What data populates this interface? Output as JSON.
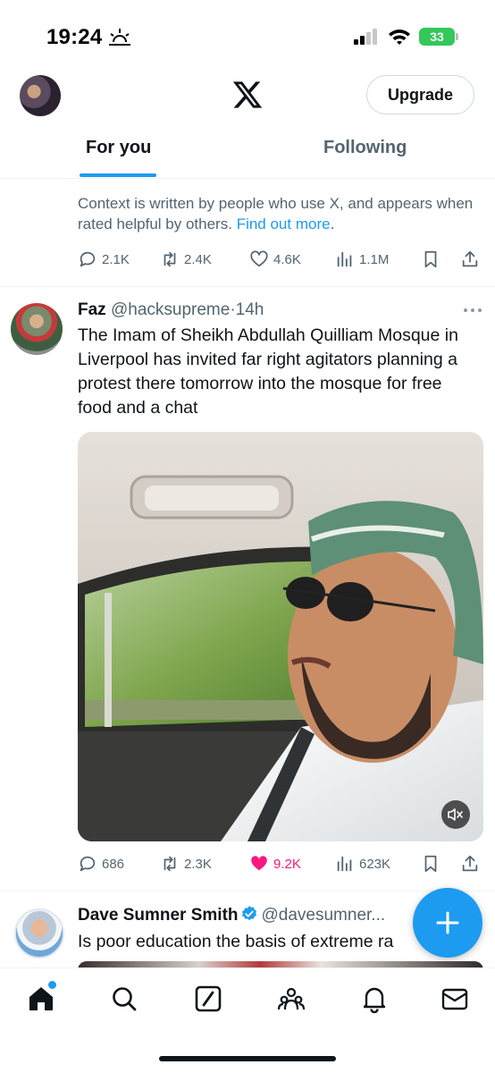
{
  "status_bar": {
    "time": "19:24",
    "battery": "33"
  },
  "header": {
    "upgrade_label": "Upgrade"
  },
  "tabs": [
    {
      "label": "For you",
      "active": true
    },
    {
      "label": "Following",
      "active": false
    }
  ],
  "context_note": {
    "text": "Context is written by people who use X, and appears when rated helpful by others.",
    "link": "Find out more",
    "trailing": "."
  },
  "prev_tweet_actions": {
    "replies": "2.1K",
    "reposts": "2.4K",
    "likes": "4.6K",
    "views": "1.1M"
  },
  "tweet": {
    "name": "Faz",
    "handle": "@hacksupreme",
    "separator": "·",
    "time": "14h",
    "text": "The Imam of Sheikh Abdullah Quilliam Mosque in Liverpool has invited far right agitators planning a protest there tomorrow into the mosque for free food and a chat",
    "actions": {
      "replies": "686",
      "reposts": "2.3K",
      "likes": "9.2K",
      "views": "623K",
      "liked": true
    }
  },
  "next_tweet": {
    "name": "Dave Sumner Smith",
    "handle": "@davesumner...",
    "text": "Is poor education the basis of extreme ra"
  },
  "colors": {
    "accent": "#1d9bf0",
    "like": "#f91880",
    "muted": "#536471",
    "battery": "#34c759"
  },
  "icons": {
    "nav": [
      "home-icon",
      "search-icon",
      "grok-icon",
      "communities-icon",
      "notifications-icon",
      "messages-icon"
    ],
    "fab": "compose-plus-icon"
  }
}
